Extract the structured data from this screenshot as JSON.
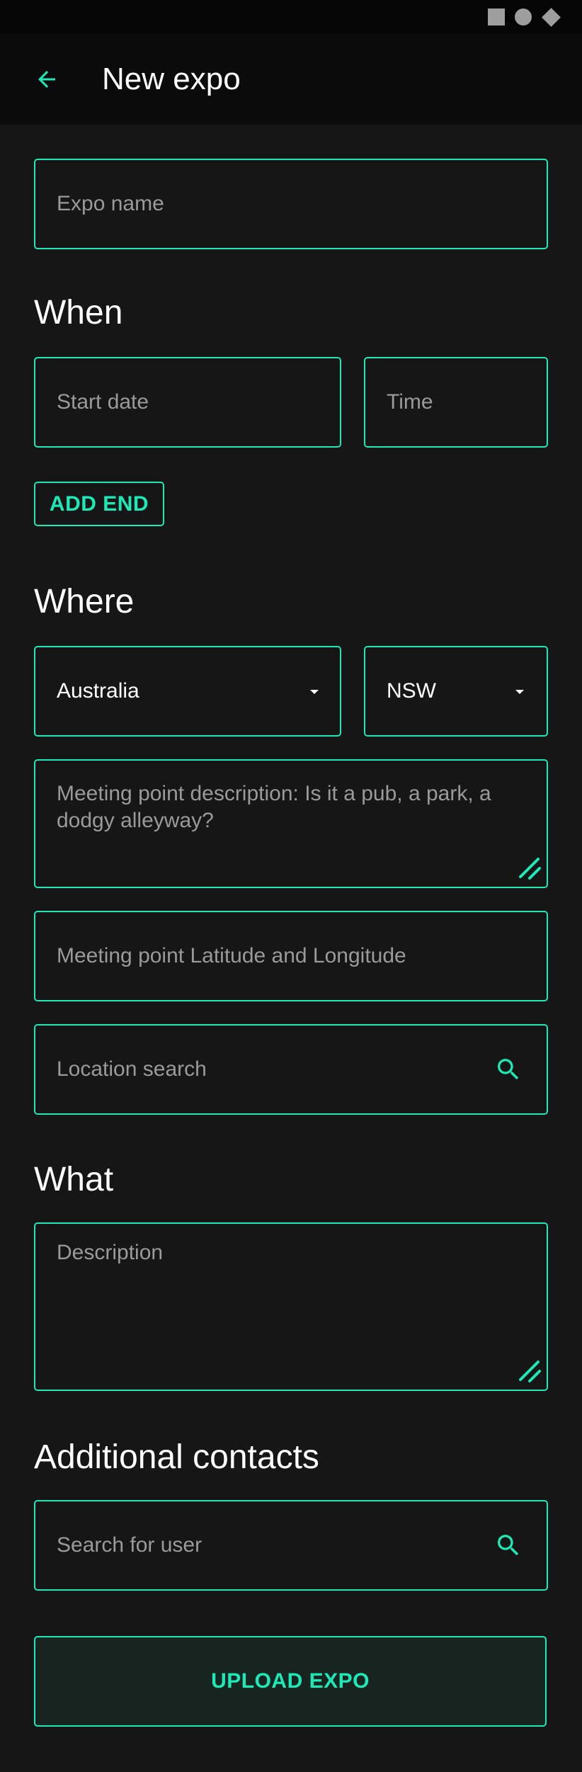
{
  "app_bar": {
    "title": "New expo"
  },
  "form": {
    "expo_name_placeholder": "Expo name",
    "when_heading": "When",
    "start_date_placeholder": "Start date",
    "time_placeholder": "Time",
    "add_end_label": "ADD END",
    "where_heading": "Where",
    "country_value": "Australia",
    "state_value": "NSW",
    "meeting_point_description_placeholder": "Meeting point description: Is it a pub, a park, a dodgy alleyway?",
    "meeting_point_latlng_placeholder": "Meeting point Latitude and Longitude",
    "location_search_placeholder": "Location search",
    "what_heading": "What",
    "description_placeholder": "Description",
    "additional_contacts_heading": "Additional contacts",
    "search_user_placeholder": "Search for user",
    "upload_label": "UPLOAD EXPO"
  },
  "colors": {
    "accent": "#1de9b6",
    "background": "#161616",
    "app_bar": "#0b0b0b",
    "status_bar": "#050505",
    "placeholder_text": "#9a9a9a"
  },
  "icons": {
    "back": "arrow-left-icon",
    "search": "search-icon",
    "dropdown": "caret-down-icon",
    "resize": "textarea-resize-icon",
    "status": [
      "square-icon",
      "circle-icon",
      "diamond-icon"
    ]
  }
}
